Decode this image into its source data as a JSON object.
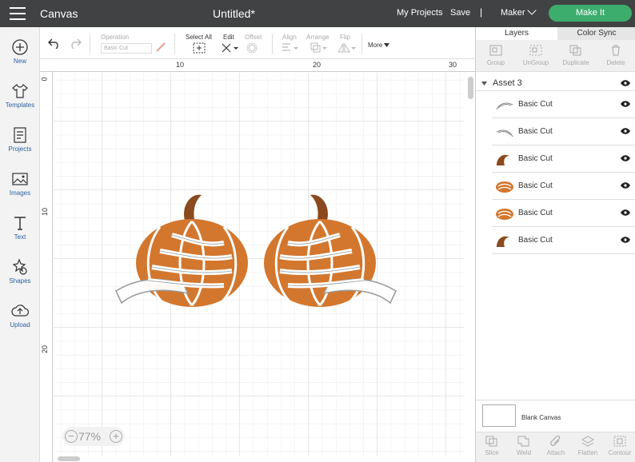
{
  "topbar": {
    "app_title": "Canvas",
    "doc_title": "Untitled*",
    "my_projects": "My Projects",
    "save": "Save",
    "separator": "|",
    "machine": "Maker",
    "make_it": "Make It"
  },
  "leftbar": {
    "items": [
      {
        "label": "New",
        "icon": "plus-circle-icon"
      },
      {
        "label": "Templates",
        "icon": "tshirt-icon"
      },
      {
        "label": "Projects",
        "icon": "projects-icon"
      },
      {
        "label": "Images",
        "icon": "image-icon"
      },
      {
        "label": "Text",
        "icon": "text-icon"
      },
      {
        "label": "Shapes",
        "icon": "shapes-icon"
      },
      {
        "label": "Upload",
        "icon": "upload-icon"
      }
    ]
  },
  "toolbar": {
    "operation_label": "Operation",
    "operation_value": "Basic Cut",
    "select_all": "Select All",
    "edit": "Edit",
    "offset": "Offset",
    "align": "Align",
    "arrange": "Arrange",
    "flip": "Flip",
    "more": "More"
  },
  "canvas": {
    "ruler_top": [
      "10",
      "20",
      "30"
    ],
    "ruler_left": [
      "0",
      "10",
      "20"
    ],
    "zoom": "77%",
    "zoom_out": "−",
    "zoom_in": "+"
  },
  "panel": {
    "tabs": [
      "Layers",
      "Color Sync"
    ],
    "layer_tools": [
      "Group",
      "UnGroup",
      "Duplicate",
      "Delete"
    ],
    "group_name": "Asset 3",
    "layers": [
      {
        "label": "Basic Cut",
        "thumb": "white"
      },
      {
        "label": "Basic Cut",
        "thumb": "white"
      },
      {
        "label": "Basic Cut",
        "thumb": "#8a4a1e"
      },
      {
        "label": "Basic Cut",
        "thumb": "#d3772e"
      },
      {
        "label": "Basic Cut",
        "thumb": "#d3772e"
      },
      {
        "label": "Basic Cut",
        "thumb": "#8a4a1e"
      }
    ],
    "blank_canvas": "Blank Canvas",
    "bottom_tools": [
      "Slice",
      "Weld",
      "Attach",
      "Flatten",
      "Contour"
    ]
  },
  "colors": {
    "accent_green": "#3dad6d",
    "topbar": "#414243",
    "pumpkin": "#d3772e",
    "stem": "#8a4a1e"
  }
}
